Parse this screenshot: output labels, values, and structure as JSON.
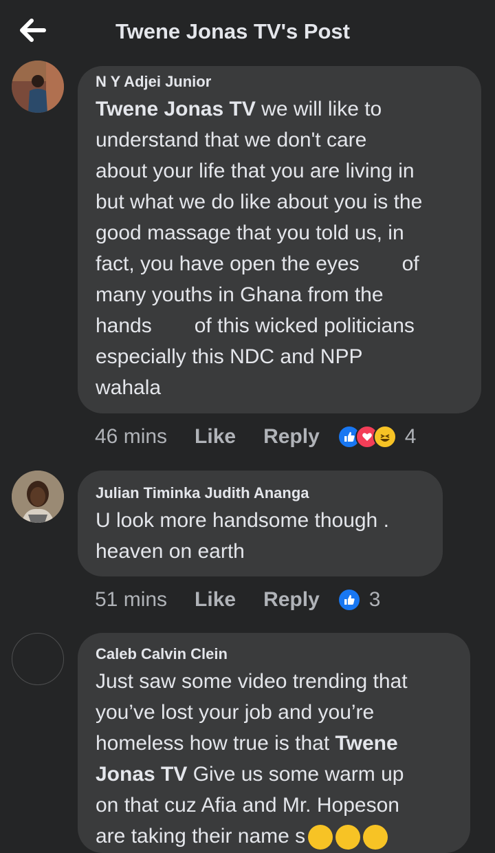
{
  "header": {
    "title": "Twene Jonas TV's Post"
  },
  "comments": [
    {
      "author": "N Y Adjei Junior",
      "segments": [
        {
          "t": "Twene Jonas TV",
          "bold": true
        },
        {
          "t": " we will like to understand that we don't care about your life that you are living in but what we do like about you is the good massage that you told us, in fact, you have open the eyes "
        }
      ],
      "lines": [
        [
          "understand that we don't care"
        ],
        [
          "about your life that you are living in"
        ],
        [
          "but what we do like about you is the"
        ],
        [
          "good massage that you told us, in"
        ],
        [
          "fact, you have open the eyes",
          "of"
        ],
        [
          "many youths in Ghana from the"
        ],
        [
          "hands",
          "of this wicked politicians"
        ],
        [
          "especially this NDC and NPP"
        ],
        [
          "wahala"
        ]
      ],
      "first_line_bold": "Twene Jonas TV",
      "first_line_rest": " we will like to",
      "time": "46 mins",
      "like": "Like",
      "reply": "Reply",
      "reaction_count": "4",
      "reactions": [
        "like-reaction",
        "love-reaction",
        "haha-reaction"
      ]
    },
    {
      "author": "Julian Timinka Judith Ananga",
      "lines": [
        [
          "U look more handsome though ."
        ],
        [
          "heaven on earth"
        ]
      ],
      "time": "51 mins",
      "like": "Like",
      "reply": "Reply",
      "reaction_count": "3",
      "reactions": [
        "like-reaction"
      ]
    },
    {
      "author": "Caleb Calvin Clein",
      "line1": "Just saw some video trending that",
      "line2": "you’ve lost your job and you’re",
      "line3a": "homeless how true is that ",
      "line3b": "Twene",
      "line4a": "Jonas TV",
      "line4b": " Give us some warm up",
      "line5": "on that cuz Afia and Mr. Hopeson",
      "line6": "are taking their name s"
    }
  ],
  "colors": {
    "background": "#242526",
    "bubble": "#3a3b3c",
    "text": "#e4e6eb",
    "meta": "#b0b3b8",
    "like_blue": "#1877f2",
    "love_red": "#f33e58",
    "haha_yellow": "#f7c325"
  }
}
